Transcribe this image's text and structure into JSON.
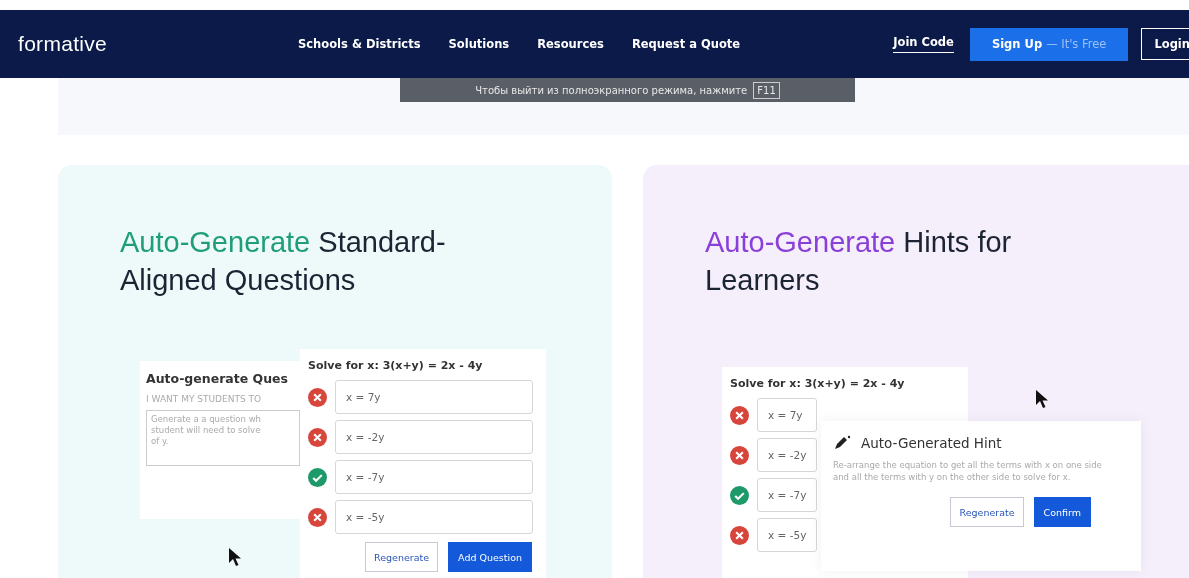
{
  "nav": {
    "logo": "formative",
    "links": [
      "Schools & Districts",
      "Solutions",
      "Resources",
      "Request a Quote"
    ],
    "join_code": "Join Code",
    "sign_up": {
      "label": "Sign Up",
      "suffix": "— It's Free"
    },
    "login": "Login"
  },
  "toast": {
    "text": "Чтобы выйти из полноэкранного режима, нажмите",
    "key": "F11"
  },
  "features": [
    {
      "kind": "questions",
      "accent": "Auto-Generate",
      "title": "Standard-Aligned Questions",
      "color": "#1f9e77",
      "generator": {
        "title": "Auto-generate Ques",
        "label": "I WANT MY STUDENTS TO",
        "lines": [
          "Generate a a question wh",
          "student will need to solve",
          "of y."
        ]
      },
      "question": "Solve for x: 3(x+y) = 2x - 4y",
      "answers": [
        {
          "text": "x = 7y",
          "correct": false
        },
        {
          "text": "x = -2y",
          "correct": false
        },
        {
          "text": "x = -7y",
          "correct": true
        },
        {
          "text": "x = -5y",
          "correct": false
        }
      ],
      "buttons": [
        "Regenerate",
        "Add Question"
      ]
    },
    {
      "kind": "hints",
      "accent": "Auto-Generate",
      "title": "Hints for Learners",
      "color": "#8a3fd8",
      "question": "Solve for x: 3(x+y) = 2x - 4y",
      "answers": [
        {
          "text": "x = 7y",
          "correct": false
        },
        {
          "text": "x = -2y",
          "correct": false
        },
        {
          "text": "x = -7y",
          "correct": true
        },
        {
          "text": "x = -5y",
          "correct": false
        }
      ],
      "hint": {
        "title": "Auto-Generated Hint",
        "text": "Re-arrange the equation to get all the terms with x on one side and all the terms with y on the other side to solve for x."
      },
      "buttons": [
        "Regenerate",
        "Confirm"
      ]
    }
  ]
}
